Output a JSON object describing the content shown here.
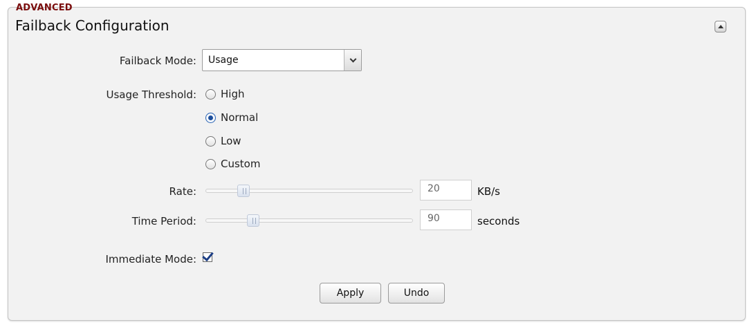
{
  "section": {
    "tag": "ADVANCED",
    "title": "Failback Configuration"
  },
  "icons": {
    "collapse": "collapse-up-icon",
    "select_arrow": "chevron-down-icon",
    "checkmark": "checkmark-icon"
  },
  "failback_mode": {
    "label": "Failback Mode:",
    "selected": "Usage"
  },
  "usage_threshold": {
    "label": "Usage Threshold:",
    "options": [
      {
        "label": "High",
        "checked": false
      },
      {
        "label": "Normal",
        "checked": true
      },
      {
        "label": "Low",
        "checked": false
      },
      {
        "label": "Custom",
        "checked": false
      }
    ]
  },
  "rate": {
    "label": "Rate:",
    "value": "20",
    "unit": "KB/s"
  },
  "time_period": {
    "label": "Time Period:",
    "value": "90",
    "unit": "seconds"
  },
  "immediate_mode": {
    "label": "Immediate Mode:",
    "checked": true
  },
  "buttons": {
    "apply": "Apply",
    "undo": "Undo"
  },
  "colors": {
    "section_tag": "#7a0c0c",
    "panel_background": "#f2f2f2",
    "checkbox_mark": "#1d3f86",
    "radio_selected": "#1e4f9c"
  }
}
